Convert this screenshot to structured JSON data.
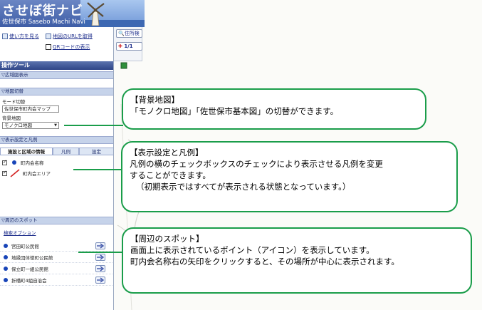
{
  "banner": {
    "title": "させぼ街ナビ",
    "subtitle": "佐世保市 Sasebo Machi Navi"
  },
  "toplinks": {
    "howto": "使い方を見る",
    "map_url": "地図のURLを取得",
    "qrcode": "QRコードの表示"
  },
  "map_toolbar": {
    "address_search": "住所検",
    "page_indicator": "1/1"
  },
  "panel": {
    "title": "操作ツール",
    "wide_map": "▽広域図表示",
    "map_switch": "▽地図切替",
    "mode_label": "モード切替",
    "mode_value": "佐世保市町内会マップ",
    "background_label": "背景地図",
    "background_value": "モノクロ地図",
    "display_settings": "▽表示設定と凡例",
    "tabs": [
      "施設と区域の情報",
      "凡例",
      "設定"
    ],
    "legend": [
      {
        "label": "町内会名称"
      },
      {
        "label": "町内会エリア"
      }
    ],
    "nearby_spots": "▽周辺のスポット",
    "search_options": "検索オプション",
    "spots": [
      {
        "label": "宮田町公民館"
      },
      {
        "label": "地縁団体徳町公民館"
      },
      {
        "label": "保立町一組公民館"
      },
      {
        "label": "折橋町4組自治会"
      }
    ]
  },
  "callouts": {
    "background_map": {
      "title": "【背景地図】",
      "lines": [
        "「モノクロ地図」「佐世保市基本図」の切替ができます。"
      ]
    },
    "display_legend": {
      "title": "【表示設定と凡例】",
      "lines": [
        "凡例の横のチェックボックスのチェックにより表示させる凡例を変更",
        "することができます。",
        "（初期表示ではすべてが表示される状態となっています。）"
      ]
    },
    "nearby_spots": {
      "title": "【周辺のスポット】",
      "lines": [
        "画面上に表示されているポイント（アイコン）を表示しています。",
        "町内会名称右の矢印をクリックすると、その場所が中心に表示されます。"
      ]
    }
  },
  "colors": {
    "callout_border": "#1a9d4a",
    "header_bar": "#3a5196",
    "section_bar": "#c6d3ea",
    "link": "#1f2f8c",
    "spot_dot": "#1844b8",
    "legend_line": "#d32020"
  }
}
